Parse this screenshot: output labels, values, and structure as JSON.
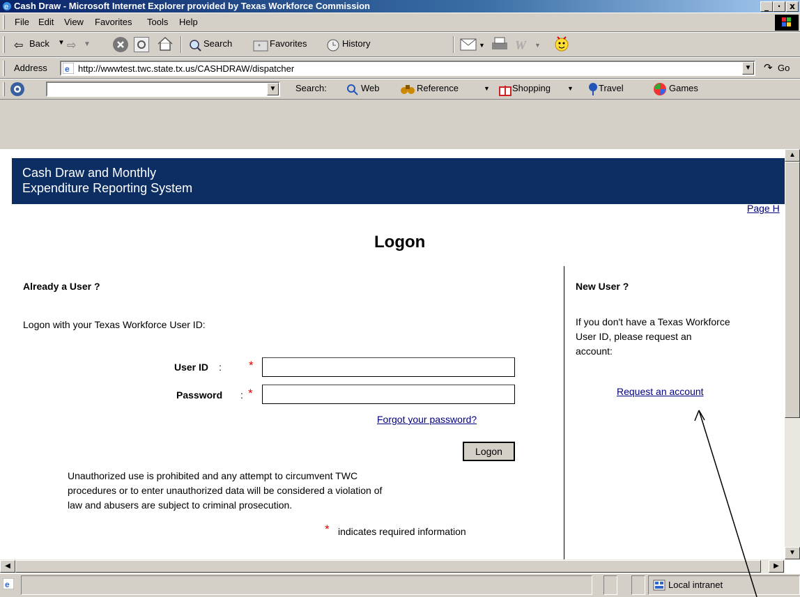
{
  "window": {
    "title": "Cash Draw - Microsoft Internet Explorer provided by Texas Workforce Commission",
    "controls": [
      "_",
      "·",
      "x"
    ]
  },
  "menu": {
    "items": [
      "File",
      "Edit",
      "View",
      "Favorites",
      "Tools",
      "Help"
    ]
  },
  "toolbar": {
    "back": "Back",
    "search": "Search",
    "favorites": "Favorites",
    "history": "History"
  },
  "address": {
    "label": "Address",
    "url": "http://wwwtest.twc.state.tx.us/CASHDRAW/dispatcher",
    "go": "Go"
  },
  "searchbar": {
    "label": "Search:",
    "web": "Web",
    "reference": "Reference",
    "shopping": "Shopping",
    "travel": "Travel",
    "games": "Games"
  },
  "page": {
    "banner_line1": "Cash Draw and Monthly",
    "banner_line2": "Expenditure Reporting System",
    "page_help": "Page H",
    "heading": "Logon",
    "left": {
      "title": "Already a User ?",
      "intro": "Logon with your Texas Workforce User ID:",
      "user_id_label": "User ID",
      "password_label": "Password",
      "colon": ":",
      "required_mark": "*",
      "forgot": "Forgot your password?",
      "logon_button": "Logon",
      "disclaimer_1": "Unauthorized use is prohibited and any attempt to circumvent TWC",
      "disclaimer_2": "procedures or to enter unauthorized data will be considered a violation of",
      "disclaimer_3": "law and abusers are subject to criminal prosecution.",
      "required_note": "indicates required information"
    },
    "right": {
      "title": "New User ?",
      "text_1": "If you don't have a Texas Workforce",
      "text_2": "User ID, please request an",
      "text_3": "account:",
      "request_link": "Request an account"
    }
  },
  "status": {
    "zone": "Local intranet"
  },
  "colors": {
    "banner": "#0c2e63",
    "link": "#00007f",
    "required": "#e00000"
  }
}
